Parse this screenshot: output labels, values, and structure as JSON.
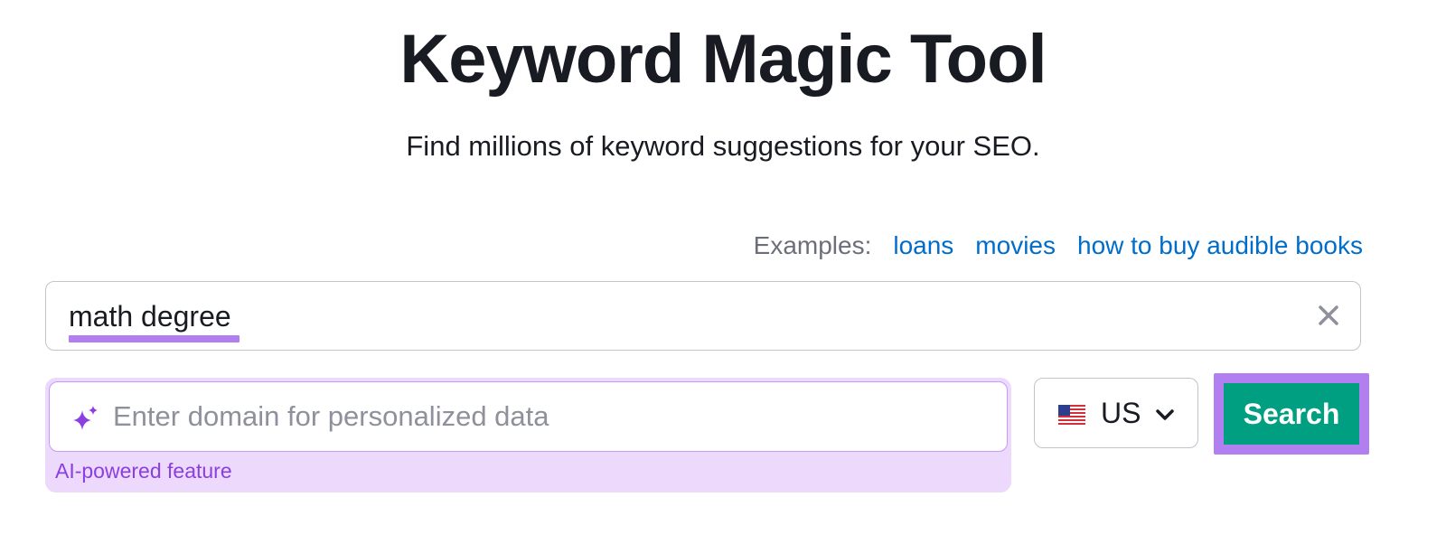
{
  "header": {
    "title": "Keyword Magic Tool",
    "subtitle": "Find millions of keyword suggestions for your SEO."
  },
  "examples": {
    "label": "Examples:",
    "links": [
      "loans",
      "movies",
      "how to buy audible books"
    ]
  },
  "keyword_input": {
    "value": "math degree",
    "clear_icon": "close-icon"
  },
  "domain_input": {
    "placeholder": "Enter domain for personalized data",
    "icon": "sparkle-icon",
    "ai_label": "AI-powered feature"
  },
  "database_select": {
    "value": "US",
    "flag_icon": "us-flag-icon",
    "chevron_icon": "chevron-down-icon"
  },
  "search_button": {
    "label": "Search"
  },
  "colors": {
    "accent_purple": "#b27ff0",
    "ai_background": "#ecd9fc",
    "ai_text": "#8b3fe0",
    "link_blue": "#006dca",
    "button_green": "#009f81",
    "text_dark": "#191b23",
    "text_muted": "#6c6e79",
    "border_gray": "#c2c4cc"
  }
}
